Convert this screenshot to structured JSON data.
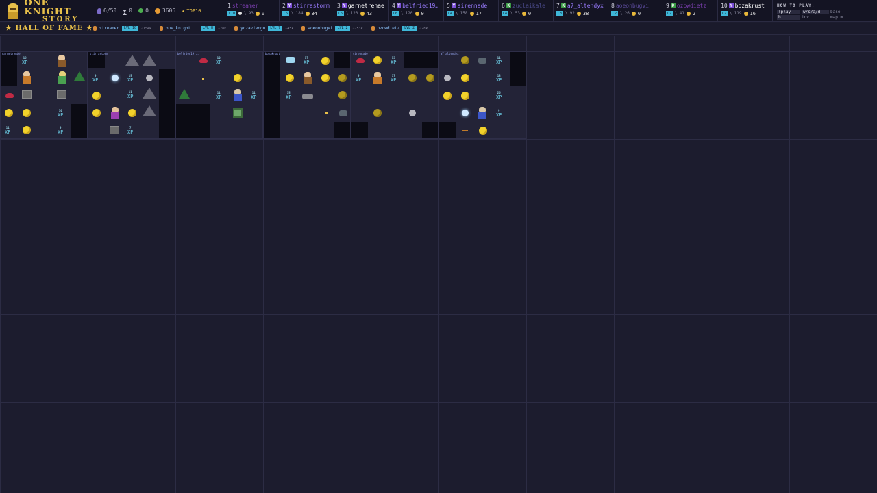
{
  "brand": {
    "title": "ONE KNIGHT",
    "subtitle": "STORY"
  },
  "stats": {
    "players": "6/50",
    "time": "0",
    "kills": "0",
    "coins": "3606",
    "top10_label": "TOP10"
  },
  "leaderboard": [
    {
      "rank": "1",
      "tier": "",
      "name": "streamer",
      "lvl": "L10",
      "score": "93",
      "coins": "0",
      "color": "#7b3fb0",
      "skull": true
    },
    {
      "rank": "2",
      "tier": "Y",
      "name": "stirrastorm",
      "lvl": "L6",
      "score": "184",
      "coins": "34",
      "color": "#9a7cff",
      "skull": false
    },
    {
      "rank": "3",
      "tier": "Y",
      "name": "garnetrenae",
      "lvl": "L6",
      "score": "123",
      "coins": "43",
      "color": "#ffffff",
      "skull": false
    },
    {
      "rank": "4",
      "tier": "Y",
      "name": "belfried19...",
      "lvl": "L6",
      "score": "120",
      "coins": "0",
      "color": "#9a7cff",
      "skull": false
    },
    {
      "rank": "5",
      "tier": "Y",
      "name": "sirennade",
      "lvl": "L4",
      "score": "158",
      "coins": "17",
      "color": "#9a7cff",
      "skull": false
    },
    {
      "rank": "6",
      "tier": "K",
      "name": "zuclaikale",
      "lvl": "L4",
      "score": "53",
      "coins": "0",
      "color": "#4a4a8a",
      "skull": false
    },
    {
      "rank": "7",
      "tier": "K",
      "name": "a7_altendyx",
      "lvl": "L3",
      "score": "92",
      "coins": "38",
      "color": "#9a7cff",
      "skull": false
    },
    {
      "rank": "8",
      "tier": "",
      "name": "aoeonbugvi",
      "lvl": "L2",
      "score": "26",
      "coins": "0",
      "color": "#5a4a9a",
      "skull": false
    },
    {
      "rank": "9",
      "tier": "K",
      "name": "ozowdietz",
      "lvl": "L2",
      "score": "41",
      "coins": "2",
      "color": "#7b3fb0",
      "skull": false
    },
    {
      "rank": "10",
      "tier": "Y",
      "name": "bozakrust",
      "lvl": "L2",
      "score": "119",
      "coins": "16",
      "color": "#ffffff",
      "skull": false
    }
  ],
  "howto": {
    "title": "HOW TO PLAY:",
    "rows": [
      [
        "!play",
        "w/s/a/d",
        "base"
      ],
      [
        "b",
        "inv  i",
        "map  m"
      ]
    ]
  },
  "hall_of_fame": {
    "title": "★ HALL OF FAME ★",
    "entries": [
      {
        "name": "streamer",
        "lvl": "LVL 10",
        "score": "☆154k"
      },
      {
        "name": "one_knight...",
        "lvl": "LVL 8",
        "score": "☆78k"
      },
      {
        "name": "yozaviengo",
        "lvl": "LVL 7",
        "score": "☆45k"
      },
      {
        "name": "aoeonbugvi",
        "lvl": "LVL 2",
        "score": "☆253k"
      },
      {
        "name": "ozowdietz",
        "lvl": "LVL 2",
        "score": "☆28k"
      }
    ]
  },
  "zones": [
    {
      "label": "garnetrenae"
    },
    {
      "label": "stirrastorm"
    },
    {
      "label": "belfried19..."
    },
    {
      "label": "bozakrust"
    },
    {
      "label": "sirennade"
    },
    {
      "label": "a7_altendyx"
    }
  ],
  "colors": {
    "accent_gold": "#e8c04a",
    "level_badge": "#3fb7d8",
    "tier_Y": "#7b4fd6",
    "tier_K": "#3a9a45"
  }
}
